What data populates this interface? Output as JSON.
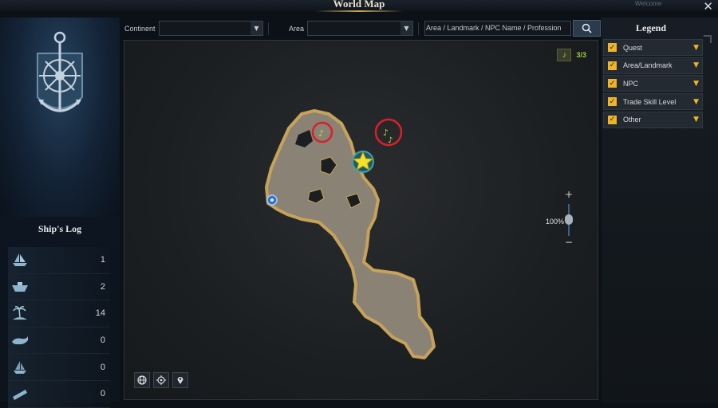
{
  "window": {
    "title": "World Map",
    "close_glyph": "✕",
    "background_text": "Welcome"
  },
  "ships_log": {
    "title": "Ship's Log",
    "rows": [
      {
        "icon": "sailing-ship-icon",
        "count": "1"
      },
      {
        "icon": "boat-hull-icon",
        "count": "2"
      },
      {
        "icon": "palm-island-icon",
        "count": "14"
      },
      {
        "icon": "whale-icon",
        "count": "0"
      },
      {
        "icon": "ghost-ship-icon",
        "count": "0"
      },
      {
        "icon": "telescope-icon",
        "count": "0"
      }
    ]
  },
  "filters": {
    "continent_label": "Continent",
    "continent_value": "",
    "area_label": "Area",
    "area_value": "",
    "search_text": "Area / Landmark / NPC Name / Profession"
  },
  "map": {
    "collectible_counter": "3/3",
    "zoom_level": "100%",
    "zoom_plus": "+",
    "zoom_minus": "−"
  },
  "legend": {
    "title": "Legend",
    "items": [
      {
        "label": "Quest",
        "checked": true
      },
      {
        "label": "Area/Landmark",
        "checked": true
      },
      {
        "label": "NPC",
        "checked": true
      },
      {
        "label": "Trade Skill Level",
        "checked": true
      },
      {
        "label": "Other",
        "checked": true
      }
    ]
  },
  "colors": {
    "accent_gold": "#f0b428",
    "counter_green": "#9ed042",
    "highlight_red": "#d8202a",
    "island_fill": "#8a8274"
  }
}
